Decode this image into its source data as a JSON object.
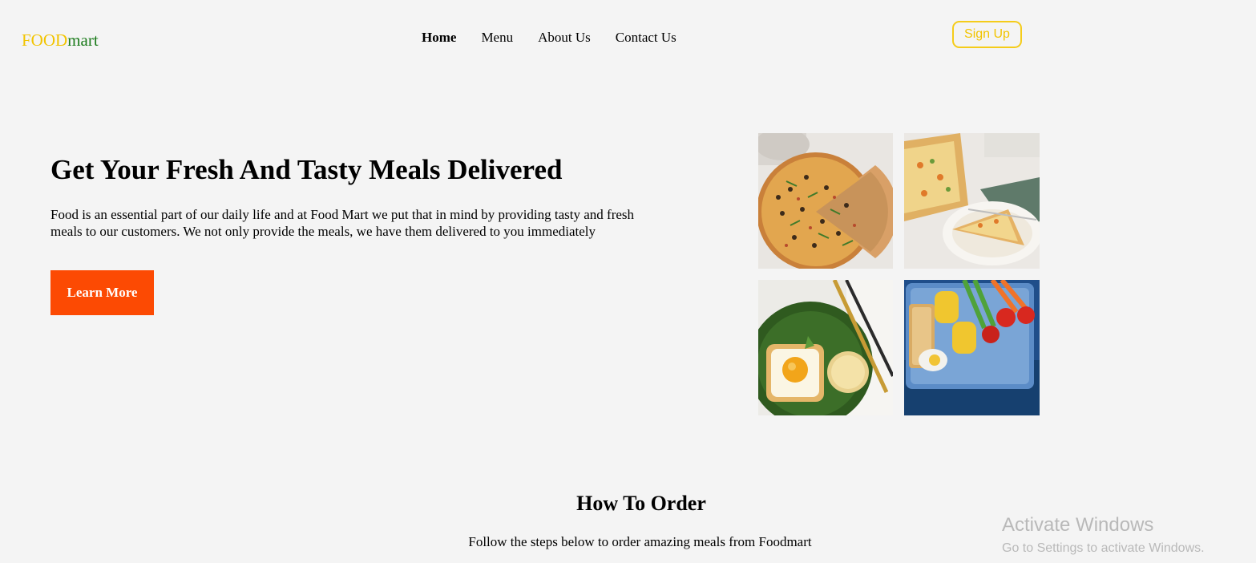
{
  "header": {
    "logo_part1": "FOOD",
    "logo_part2": "mart",
    "nav": [
      {
        "label": "Home",
        "active": true
      },
      {
        "label": "Menu",
        "active": false
      },
      {
        "label": "About Us",
        "active": false
      },
      {
        "label": "Contact Us",
        "active": false
      }
    ],
    "signup_label": "Sign Up"
  },
  "hero": {
    "title": "Get Your Fresh And Tasty Meals Delivered",
    "text": "Food is an essential part of our daily life and at Food Mart we put that in mind by providing tasty and fresh meals to our customers. We not only provide the meals, we have them delivered to you immediately",
    "button_label": "Learn More",
    "images": [
      "pizza-image",
      "quiche-image",
      "egg-toast-image",
      "lunchbox-image"
    ]
  },
  "how_to_order": {
    "title": "How To Order",
    "subtitle": "Follow the steps below to order amazing meals from Foodmart"
  },
  "watermark": {
    "title": "Activate Windows",
    "subtitle": "Go to Settings to activate Windows."
  },
  "colors": {
    "background": "#f4f4f4",
    "logo_yellow": "#f2c400",
    "logo_green": "#1a7a1a",
    "signup_border": "#f5cc1a",
    "cta_orange": "#fc4a03"
  }
}
